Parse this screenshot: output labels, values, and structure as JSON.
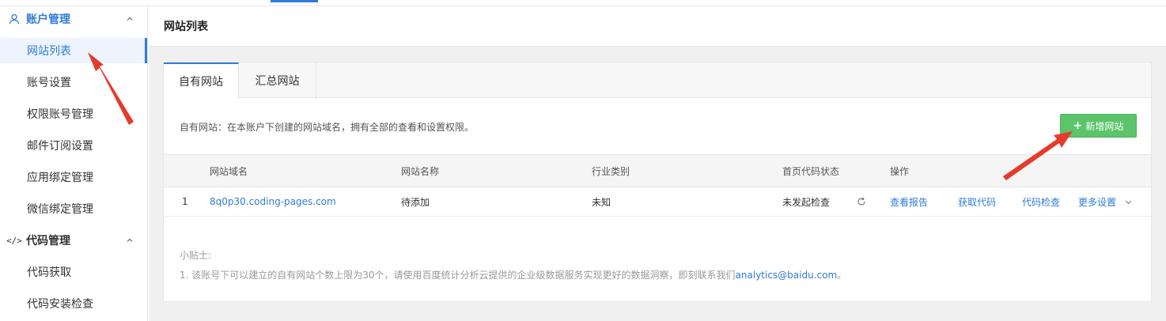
{
  "sidebar": {
    "groups": [
      {
        "label": "账户管理",
        "icon": "user-icon",
        "items": [
          {
            "label": "网站列表",
            "active": true
          },
          {
            "label": "账号设置"
          },
          {
            "label": "权限账号管理"
          },
          {
            "label": "邮件订阅设置"
          },
          {
            "label": "应用绑定管理"
          },
          {
            "label": "微信绑定管理"
          }
        ]
      },
      {
        "label": "代码管理",
        "icon": "code-icon",
        "items": [
          {
            "label": "代码获取"
          },
          {
            "label": "代码安装检查"
          }
        ]
      }
    ]
  },
  "header": {
    "title": "网站列表"
  },
  "tabs": [
    {
      "label": "自有网站",
      "active": true
    },
    {
      "label": "汇总网站"
    }
  ],
  "description": "自有网站：在本账户下创建的网站域名，拥有全部的查看和设置权限。",
  "add_button": {
    "label": "新增网站",
    "color": "#5cc46a"
  },
  "table": {
    "columns": [
      "网站域名",
      "网站名称",
      "行业类别",
      "首页代码状态",
      "操作"
    ],
    "rows": [
      {
        "index": "1",
        "domain": "8q0p30.coding-pages.com",
        "name": "待添加",
        "industry": "未知",
        "code_status": "未发起检查",
        "actions": [
          "查看报告",
          "获取代码",
          "代码检查",
          "更多设置"
        ]
      }
    ]
  },
  "tips": {
    "title": "小贴士:",
    "line_prefix": "1. 该账号下可以建立的自有网站个数上限为30个，请使用百度统计分析云提供的企业级数据服务实现更好的数据洞察，即刻联系我们",
    "email": "analytics@baidu.com",
    "line_suffix": "。"
  },
  "colors": {
    "accent": "#2f7bd9",
    "arrow": "#e53b2c"
  }
}
